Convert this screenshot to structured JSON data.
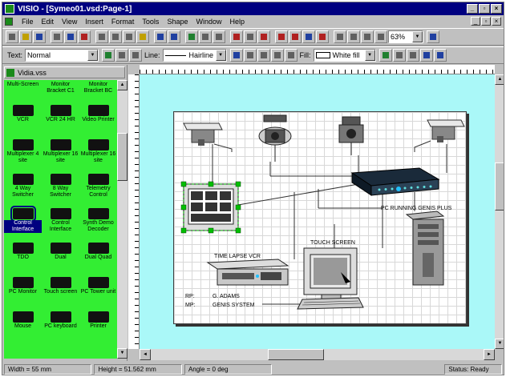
{
  "window": {
    "title": "VISIO - [Symeo01.vsd:Page-1]"
  },
  "menu": {
    "items": [
      "File",
      "Edit",
      "View",
      "Insert",
      "Format",
      "Tools",
      "Shape",
      "Window",
      "Help"
    ]
  },
  "toolbar2": {
    "text_label": "Text:",
    "text_style": "Normal",
    "line_label": "Line:",
    "line_style": "Hairline",
    "fill_label": "Fill:",
    "fill_style": "White fill",
    "zoom": "63%"
  },
  "stencil": {
    "title": "Vidia.vss",
    "masters": [
      {
        "label": "Multi-Screen",
        "kind": "top"
      },
      {
        "label": "Monitor Bracket C1",
        "kind": "top"
      },
      {
        "label": "Monitor Bracket BC",
        "kind": "top"
      },
      {
        "label": "VCR",
        "kind": "item"
      },
      {
        "label": "VCR 24 HR",
        "kind": "item"
      },
      {
        "label": "Video Printer",
        "kind": "item"
      },
      {
        "label": "Multiplexer 4 site",
        "kind": "item"
      },
      {
        "label": "Multiplexer 16 site",
        "kind": "item"
      },
      {
        "label": "Multiplexer 16 site",
        "kind": "item"
      },
      {
        "label": "4 Way Switcher",
        "kind": "item"
      },
      {
        "label": "8 Way Switcher",
        "kind": "item"
      },
      {
        "label": "Telemetry Control",
        "kind": "item"
      },
      {
        "label": "Control Interface",
        "kind": "selected"
      },
      {
        "label": "Control Interface",
        "kind": "item"
      },
      {
        "label": "Synth Demo Decoder",
        "kind": "item"
      },
      {
        "label": "TDO",
        "kind": "item"
      },
      {
        "label": "Dual",
        "kind": "item"
      },
      {
        "label": "Dual Quad",
        "kind": "item"
      },
      {
        "label": "PC Monitor",
        "kind": "item"
      },
      {
        "label": "Touch screen",
        "kind": "item"
      },
      {
        "label": "PC Tower unit",
        "kind": "item"
      },
      {
        "label": "Mouse",
        "kind": "item"
      },
      {
        "label": "PC keyboard",
        "kind": "item"
      },
      {
        "label": "Printer",
        "kind": "item"
      }
    ]
  },
  "diagram": {
    "labels": {
      "pc": "PC RUNNING GENIS PLUS",
      "vcr": "TIME LAPSE VCR",
      "touch": "TOUCH SCREEN",
      "rp_key": "RP:",
      "rp_val": "G. ADAMS",
      "mp_key": "MP:",
      "mp_val": "GENIS SYSTEM"
    }
  },
  "status": {
    "width": "Width = 55 mm",
    "height": "Height = 51.562 mm",
    "angle": "Angle = 0 deg",
    "status": "Status: Ready"
  },
  "colors": {
    "title_bar": "#000080",
    "stencil_bg": "#33ee33",
    "drawing_bg": "#aaf8f8"
  }
}
